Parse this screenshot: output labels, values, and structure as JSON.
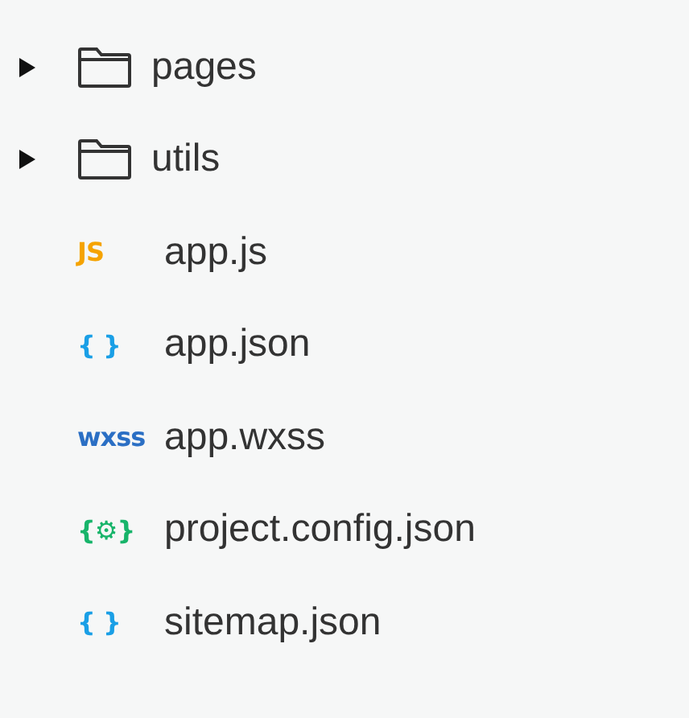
{
  "file_tree": [
    {
      "kind": "folder",
      "name": "pages",
      "expanded": false
    },
    {
      "kind": "folder",
      "name": "utils",
      "expanded": false
    },
    {
      "kind": "file",
      "name": "app.js",
      "badge": "JS",
      "color": "#f5a300"
    },
    {
      "kind": "file",
      "name": "app.json",
      "badge": "{ }",
      "color": "#1a9fe6"
    },
    {
      "kind": "file",
      "name": "app.wxss",
      "badge": "wxss",
      "color": "#2b6fc4"
    },
    {
      "kind": "file",
      "name": "project.config.json",
      "badge": "{⚙}",
      "color": "#17b46a"
    },
    {
      "kind": "file",
      "name": "sitemap.json",
      "badge": "{ }",
      "color": "#1a9fe6"
    }
  ]
}
